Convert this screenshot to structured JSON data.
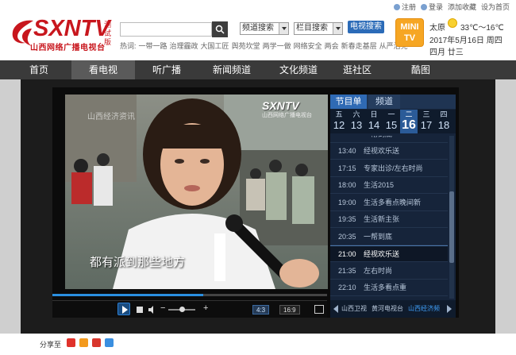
{
  "logo": {
    "text": "SXNTV",
    "sub": "山西网络广播电视台",
    "beta": "测试版"
  },
  "search": {
    "placeholder": "",
    "channel_select": "频道搜索",
    "column_select": "栏目搜索",
    "button": "电视搜索"
  },
  "hot": {
    "label": "热词:",
    "words": [
      "一带一路",
      "治理霾政",
      "大国工匠",
      "舆苑坎堂",
      "两学一做",
      "网络安全",
      "两会",
      "新春走基层",
      "从严治党"
    ]
  },
  "toplinks": [
    "注册",
    "登录",
    "添加收藏",
    "设为首页"
  ],
  "mini_tv": {
    "line1": "MINI",
    "line2": "TV"
  },
  "weather": {
    "city": "太原",
    "temp": "33℃～16℃",
    "date": "2017年5月16日 周四",
    "lunar": "四月 廿三"
  },
  "nav": [
    "首页",
    "看电视",
    "听广播",
    "新闻频道",
    "文化频道",
    "逛社区",
    "酷图"
  ],
  "nav_active": 1,
  "video": {
    "caption": "都有派到那些地方",
    "logo": "SXNTV",
    "logo_sub": "山西网络广播电视台",
    "watermark": "山西经济资讯",
    "progress": 0.55,
    "volume": 0.55,
    "ratio_a": "4:3",
    "ratio_b": "16:9"
  },
  "schedule": {
    "tab_program": "节目单",
    "tab_channel": "频道",
    "days": [
      {
        "wk": "五",
        "dn": "12"
      },
      {
        "wk": "六",
        "dn": "13"
      },
      {
        "wk": "日",
        "dn": "14"
      },
      {
        "wk": "一",
        "dn": "15"
      },
      {
        "wk": "二",
        "dn": "16"
      },
      {
        "wk": "三",
        "dn": "17"
      },
      {
        "wk": "四",
        "dn": "18"
      }
    ],
    "active_day": 4,
    "items": [
      {
        "time": "13:40",
        "name": "经视欢乐送"
      },
      {
        "time": "17:15",
        "name": "专家出诊/左右时尚"
      },
      {
        "time": "18:00",
        "name": "生活2015"
      },
      {
        "time": "19:00",
        "name": "生活多看点晚间新"
      },
      {
        "time": "19:35",
        "name": "生活新主张"
      },
      {
        "time": "20:35",
        "name": "一帮到底"
      },
      {
        "time": "21:00",
        "name": "经视欢乐送"
      },
      {
        "time": "21:35",
        "name": "左右时尚"
      },
      {
        "time": "22:10",
        "name": "生活多看点重"
      }
    ],
    "active_item": 6,
    "partial_top": "一帮到底",
    "channels": [
      "山西卫视",
      "黄河电视台",
      "山西经济频"
    ],
    "active_channel": 2
  },
  "share": {
    "label": "分享至"
  },
  "colors": {
    "brand_red": "#c8161d",
    "nav_bg": "#3a3a3a",
    "accent_blue": "#2b6bb8"
  }
}
